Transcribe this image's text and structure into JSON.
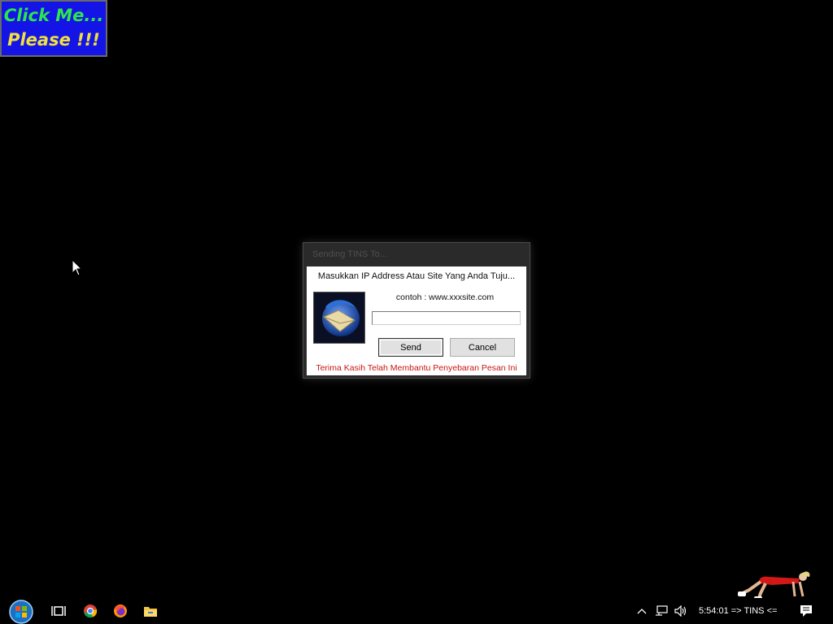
{
  "banner": {
    "line1": "Click Me...",
    "line2": "Please !!!"
  },
  "dialog": {
    "title": "Sending TINS To...",
    "prompt": "Masukkan IP Address Atau Site Yang Anda Tuju...",
    "example": "contoh : www.xxxsite.com",
    "input_value": "",
    "send_label": "Send",
    "cancel_label": "Cancel",
    "thanks": "Terima Kasih Telah Membantu Penyebaran Pesan Ini",
    "icon": "mail-envelope-icon"
  },
  "taskbar": {
    "start_icon": "windows-start-icon",
    "pinned": [
      "task-view-icon",
      "chrome-icon",
      "firefox-icon",
      "file-explorer-icon"
    ],
    "tray": {
      "clock": "5:54:01 => TINS <="
    }
  },
  "colors": {
    "banner_bg": "#1414e6",
    "banner_line1": "#2ee64a",
    "banner_line2": "#f0e040",
    "thanks_text": "#c81414"
  }
}
